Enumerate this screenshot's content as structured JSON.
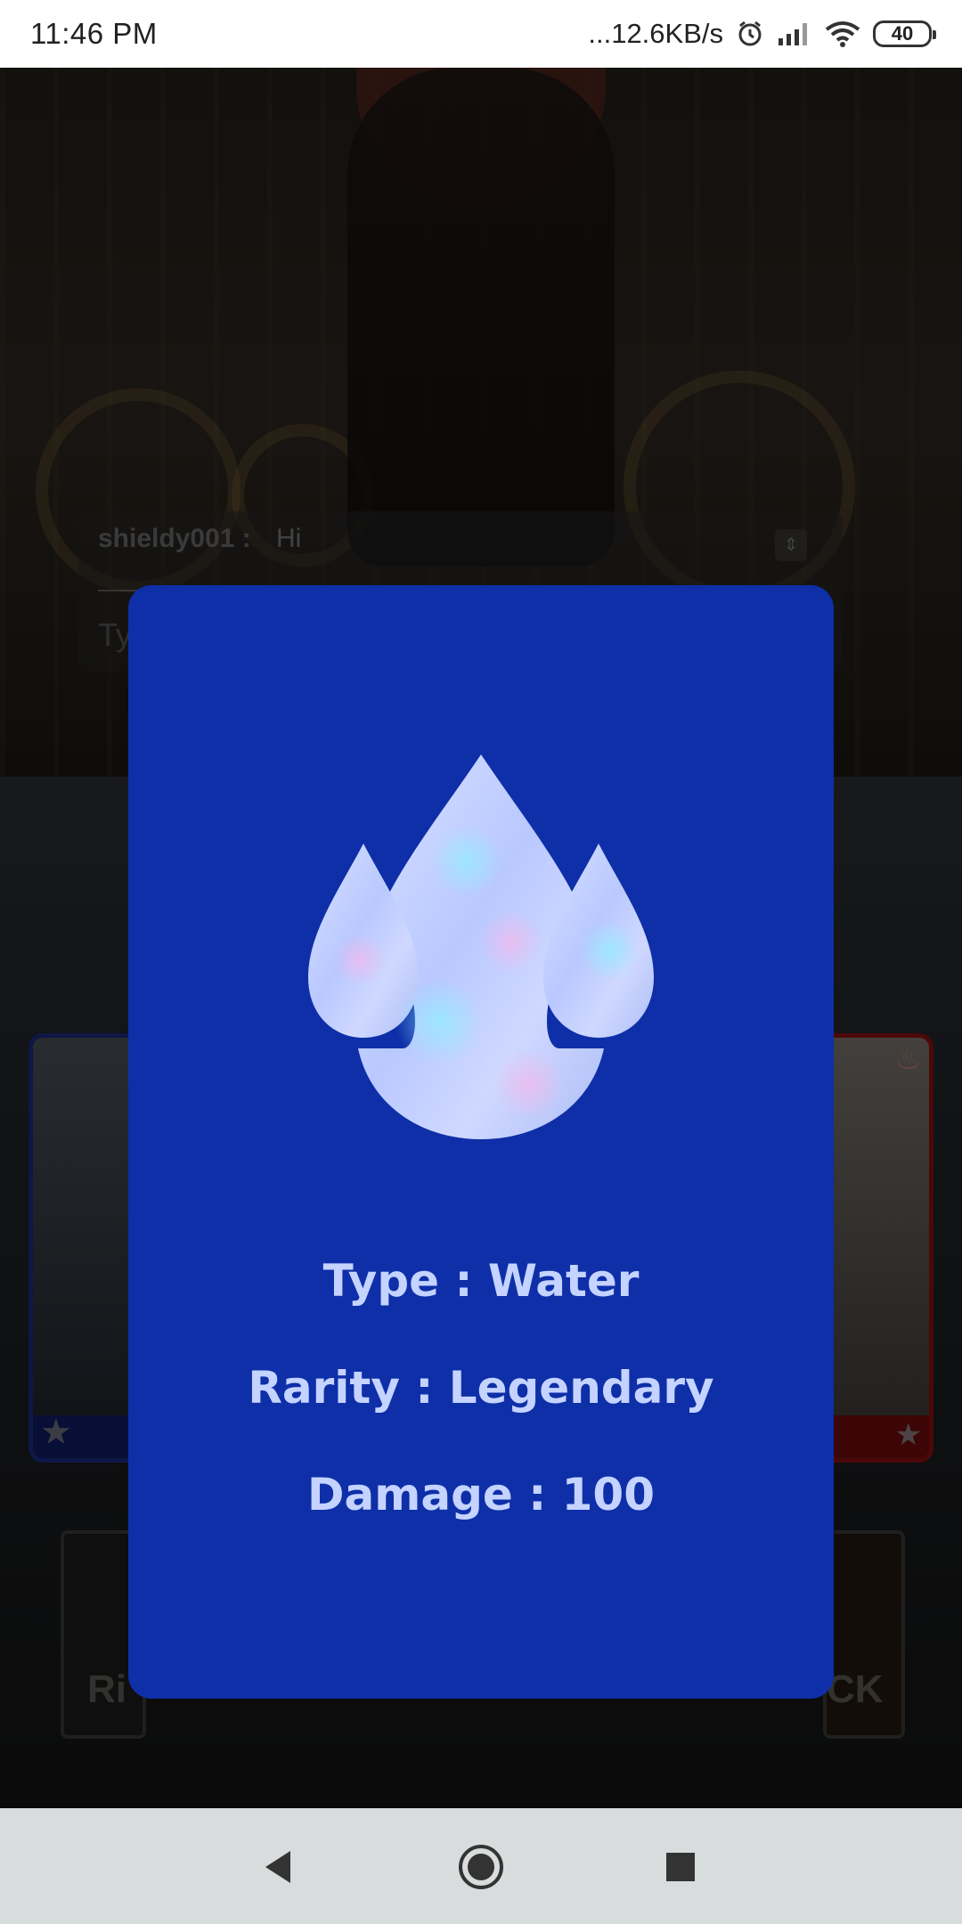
{
  "status_bar": {
    "time": "11:46 PM",
    "network_speed": "...12.6KB/s",
    "battery": "40",
    "icons": [
      "alarm-icon",
      "signal-icon",
      "wifi-icon",
      "battery-icon"
    ]
  },
  "background": {
    "chat": {
      "username": "shieldy001 :",
      "message": "Hi",
      "input_placeholder": "Ty"
    },
    "buttons": {
      "left_partial_label": "Ri",
      "right_partial_label": "CK"
    }
  },
  "card_modal": {
    "icon": "water-drops-icon",
    "type_text": "Type : Water",
    "rarity_text": "Rarity : Legendary",
    "damage_text": "Damage : 100",
    "colors": {
      "background": "#0e2fa8",
      "text": "#c4d3ff"
    }
  },
  "nav_bar": {
    "buttons": [
      "back-icon",
      "home-icon",
      "recents-icon"
    ]
  }
}
